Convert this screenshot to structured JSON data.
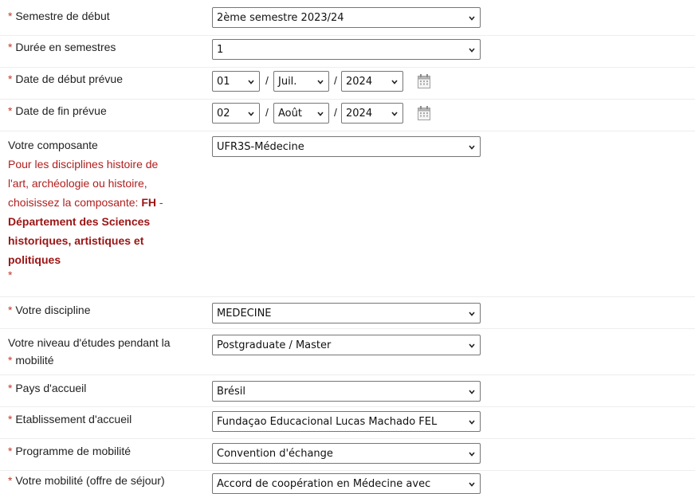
{
  "fields": {
    "semestre": {
      "label": "Semestre de début",
      "value": "2ème semestre 2023/24"
    },
    "duree": {
      "label": "Durée en semestres",
      "value": "1"
    },
    "date_debut": {
      "label": "Date de début prévue",
      "day": "01",
      "month": "Juil.",
      "year": "2024"
    },
    "date_fin": {
      "label": "Date de fin prévue",
      "day": "02",
      "month": "Août",
      "year": "2024"
    },
    "composante": {
      "label": "Votre composante",
      "value": "UFR3S-Médecine",
      "note_l1": "Pour les disciplines histoire de",
      "note_l2": "l'art, archéologie ou histoire,",
      "note_l3": "choisissez la composante: ",
      "note_fh": "FH",
      "note_dash": " -",
      "note_b1": "Département des Sciences",
      "note_b2": "historiques, artistiques et",
      "note_b3": "politiques"
    },
    "discipline": {
      "label": "Votre discipline",
      "value": "MEDECINE"
    },
    "niveau": {
      "label_l1": "Votre niveau d'études pendant la",
      "label_l2": "mobilité",
      "value": "Postgraduate / Master"
    },
    "pays": {
      "label": "Pays d'accueil",
      "value": "Brésil"
    },
    "etablissement": {
      "label": "Etablissement d'accueil",
      "value": "Fundaçao Educacional Lucas Machado FEL"
    },
    "programme": {
      "label": "Programme de mobilité",
      "value": "Convention d'échange"
    },
    "mobilite": {
      "label": "Votre mobilité (offre de séjour)",
      "value": "Accord de coopération en Médecine avec"
    }
  },
  "required_marker": "*",
  "date_separator": "/",
  "icons": {
    "chevron": "chevron-down-icon",
    "calendar": "calendar-icon"
  },
  "colors": {
    "required": "#c0392b",
    "note": "#b01e1e",
    "border": "#767676"
  }
}
